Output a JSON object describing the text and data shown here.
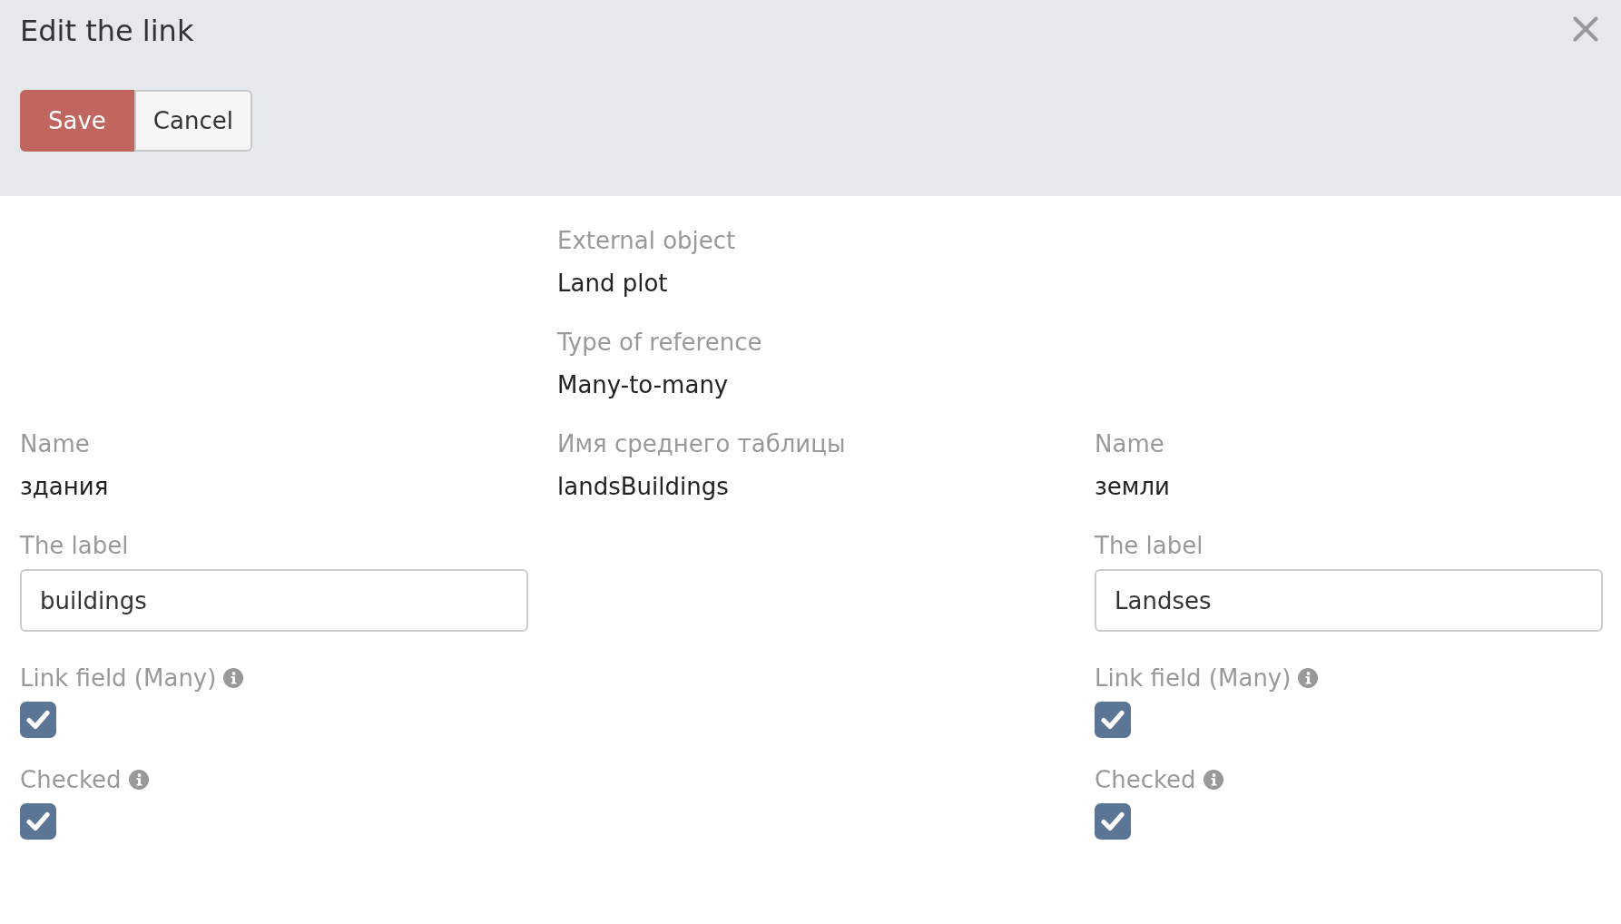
{
  "dialog": {
    "title": "Edit the link"
  },
  "toolbar": {
    "buttons": [
      {
        "kind": "primary",
        "label": "Save"
      },
      {
        "kind": "default",
        "label": "Cancel"
      }
    ]
  },
  "link": {
    "fields": [
      {
        "kind": "text",
        "label": "External object",
        "value": "Land plot"
      },
      {
        "kind": "text",
        "label": "Type of reference",
        "value": "Many-to-many"
      }
    ]
  },
  "sides": [
    {
      "fields": [
        {
          "kind": "text",
          "label": "Name",
          "value": "здания"
        },
        {
          "kind": "input",
          "label": "The label",
          "value": "buildings"
        },
        {
          "kind": "checkbox",
          "label": "Link field (Many)",
          "info": true,
          "checked": true
        },
        {
          "kind": "checkbox",
          "label": "Checked",
          "info": true,
          "checked": true
        }
      ]
    },
    {
      "fields": [
        {
          "kind": "text",
          "label": "Имя среднего таблицы",
          "value": "landsBuildings"
        }
      ]
    },
    {
      "fields": [
        {
          "kind": "text",
          "label": "Name",
          "value": "земли"
        },
        {
          "kind": "input",
          "label": "The label",
          "value": "Landses"
        },
        {
          "kind": "checkbox",
          "label": "Link field (Many)",
          "info": true,
          "checked": true
        },
        {
          "kind": "checkbox",
          "label": "Checked",
          "info": true,
          "checked": true
        }
      ]
    }
  ]
}
